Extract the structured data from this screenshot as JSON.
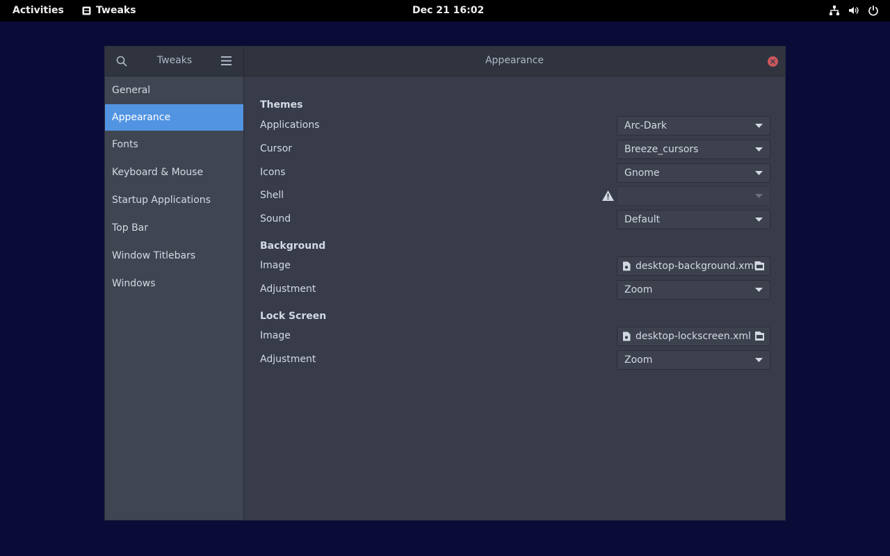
{
  "topbar": {
    "activities": "Activities",
    "app_name": "Tweaks",
    "clock": "Dec 21  16:02",
    "icons": [
      "network-icon",
      "volume-icon",
      "power-icon"
    ]
  },
  "window": {
    "sidebar_title": "Tweaks",
    "page_title": "Appearance",
    "sidebar": {
      "items": [
        {
          "label": "General"
        },
        {
          "label": "Appearance"
        },
        {
          "label": "Fonts"
        },
        {
          "label": "Keyboard & Mouse"
        },
        {
          "label": "Startup Applications"
        },
        {
          "label": "Top Bar"
        },
        {
          "label": "Window Titlebars"
        },
        {
          "label": "Windows"
        }
      ],
      "selected": "Appearance"
    },
    "themes": {
      "title": "Themes",
      "applications": {
        "label": "Applications",
        "value": "Arc-Dark"
      },
      "cursor": {
        "label": "Cursor",
        "value": "Breeze_cursors"
      },
      "icons": {
        "label": "Icons",
        "value": "Gnome"
      },
      "shell": {
        "label": "Shell",
        "value": ""
      },
      "sound": {
        "label": "Sound",
        "value": "Default"
      }
    },
    "background": {
      "title": "Background",
      "image": {
        "label": "Image",
        "value": "desktop-background.xml"
      },
      "adjustment": {
        "label": "Adjustment",
        "value": "Zoom"
      }
    },
    "lock_screen": {
      "title": "Lock Screen",
      "image": {
        "label": "Image",
        "value": "desktop-lockscreen.xml"
      },
      "adjustment": {
        "label": "Adjustment",
        "value": "Zoom"
      }
    }
  },
  "colors": {
    "desktop_bg": "#0b0b37",
    "window_bg": "#383c4a",
    "sidebar_bg": "#404552",
    "accent": "#5294e2",
    "close": "#cc575d"
  }
}
